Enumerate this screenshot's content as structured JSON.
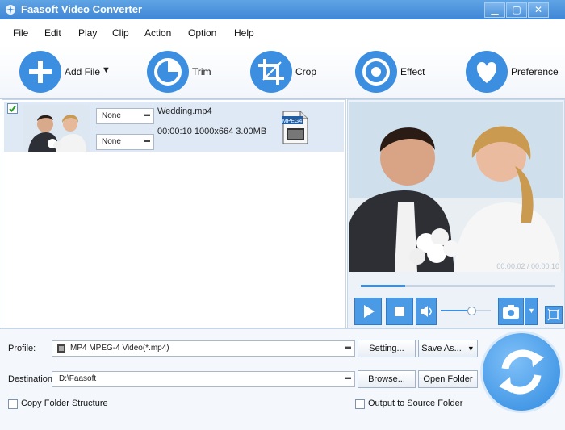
{
  "window": {
    "title": "Faasoft Video Converter"
  },
  "menu": [
    "File",
    "Edit",
    "Play",
    "Clip",
    "Action",
    "Option",
    "Help"
  ],
  "toolbar": {
    "add_file": "Add File",
    "trim": "Trim",
    "crop": "Crop",
    "effect": "Effect",
    "preference": "Preference"
  },
  "file": {
    "subtitle": "None",
    "audio": "None",
    "name": "Wedding.mp4",
    "info": "00:00:10  1000x664  3.00MB",
    "format_badge": "MPEG4"
  },
  "player": {
    "timecode": "00:00:02 / 00:00:10",
    "progress": 0.23,
    "volume": 0.62
  },
  "bottom": {
    "profile_label": "Profile:",
    "profile_value": "MP4 MPEG-4 Video(*.mp4)",
    "setting": "Setting...",
    "save_as": "Save As...",
    "destination_label": "Destination:",
    "destination_value": "D:\\Faasoft",
    "browse": "Browse...",
    "open_folder": "Open Folder",
    "copy_folder": "Copy Folder Structure",
    "output_to_source": "Output to Source Folder"
  },
  "colors": {
    "accent": "#3c8ee0",
    "titlebar": "#4a90db"
  }
}
